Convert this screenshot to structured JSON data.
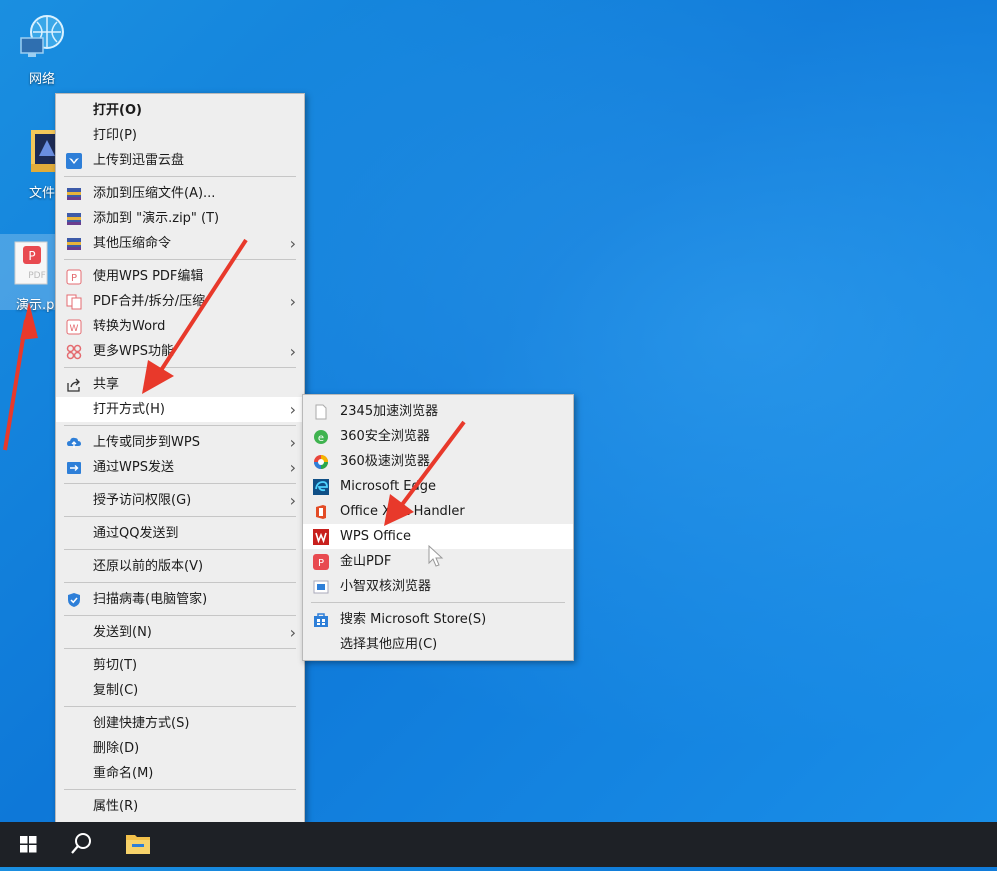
{
  "desktop": {
    "icons": [
      {
        "label": "网络"
      },
      {
        "label": "文件"
      },
      {
        "label": "演示.p"
      }
    ]
  },
  "context_menu": {
    "items": [
      {
        "label": "打开(O)",
        "icon": "none",
        "bold": true
      },
      {
        "label": "打印(P)",
        "icon": "none"
      },
      {
        "label": "上传到迅雷云盘",
        "icon": "xunlei-cloud-icon"
      },
      {
        "label": "添加到压缩文件(A)...",
        "icon": "archive-icon"
      },
      {
        "label": "添加到 \"演示.zip\" (T)",
        "icon": "archive-icon"
      },
      {
        "label": "其他压缩命令",
        "icon": "archive-icon",
        "submenu": true
      },
      {
        "label": "使用WPS PDF编辑",
        "icon": "wps-pdf-edit-icon"
      },
      {
        "label": "PDF合并/拆分/压缩",
        "icon": "pdf-merge-icon",
        "submenu": true
      },
      {
        "label": "转换为Word",
        "icon": "convert-word-icon"
      },
      {
        "label": "更多WPS功能",
        "icon": "wps-more-icon",
        "submenu": true
      },
      {
        "label": "共享",
        "icon": "share-icon"
      },
      {
        "label": "打开方式(H)",
        "icon": "none",
        "submenu": true,
        "highlighted": true
      },
      {
        "label": "上传或同步到WPS",
        "icon": "wps-cloud-icon",
        "submenu": true
      },
      {
        "label": "通过WPS发送",
        "icon": "wps-send-icon",
        "submenu": true
      },
      {
        "label": "授予访问权限(G)",
        "icon": "none",
        "submenu": true
      },
      {
        "label": "通过QQ发送到",
        "icon": "none"
      },
      {
        "label": "还原以前的版本(V)",
        "icon": "none"
      },
      {
        "label": "扫描病毒(电脑管家)",
        "icon": "antivirus-shield-icon"
      },
      {
        "label": "发送到(N)",
        "icon": "none",
        "submenu": true
      },
      {
        "label": "剪切(T)",
        "icon": "none"
      },
      {
        "label": "复制(C)",
        "icon": "none"
      },
      {
        "label": "创建快捷方式(S)",
        "icon": "none"
      },
      {
        "label": "删除(D)",
        "icon": "none"
      },
      {
        "label": "重命名(M)",
        "icon": "none"
      },
      {
        "label": "属性(R)",
        "icon": "none"
      }
    ]
  },
  "open_with_menu": {
    "items": [
      {
        "label": "2345加速浏览器",
        "icon": "blank-file-icon"
      },
      {
        "label": "360安全浏览器",
        "icon": "360-safe-browser-icon"
      },
      {
        "label": "360极速浏览器",
        "icon": "360-speed-browser-icon"
      },
      {
        "label": "Microsoft Edge",
        "icon": "edge-icon"
      },
      {
        "label": "Office XML Handler",
        "icon": "office-icon"
      },
      {
        "label": "WPS Office",
        "icon": "wps-office-icon",
        "highlighted": true
      },
      {
        "label": "金山PDF",
        "icon": "kingsoft-pdf-icon"
      },
      {
        "label": "小智双核浏览器",
        "icon": "xiaozhi-browser-icon"
      },
      {
        "label": "搜索 Microsoft Store(S)",
        "icon": "store-icon"
      },
      {
        "label": "选择其他应用(C)",
        "icon": "none"
      }
    ]
  },
  "taskbar": {
    "buttons": [
      "start-windows-icon",
      "search-icon",
      "file-explorer-icon"
    ]
  },
  "colors": {
    "desktop": "#0e78d8",
    "menu_bg": "#eeeeee",
    "highlight": "#ffffff",
    "taskbar": "#1e2126",
    "annotation_arrow": "#e8392b"
  }
}
